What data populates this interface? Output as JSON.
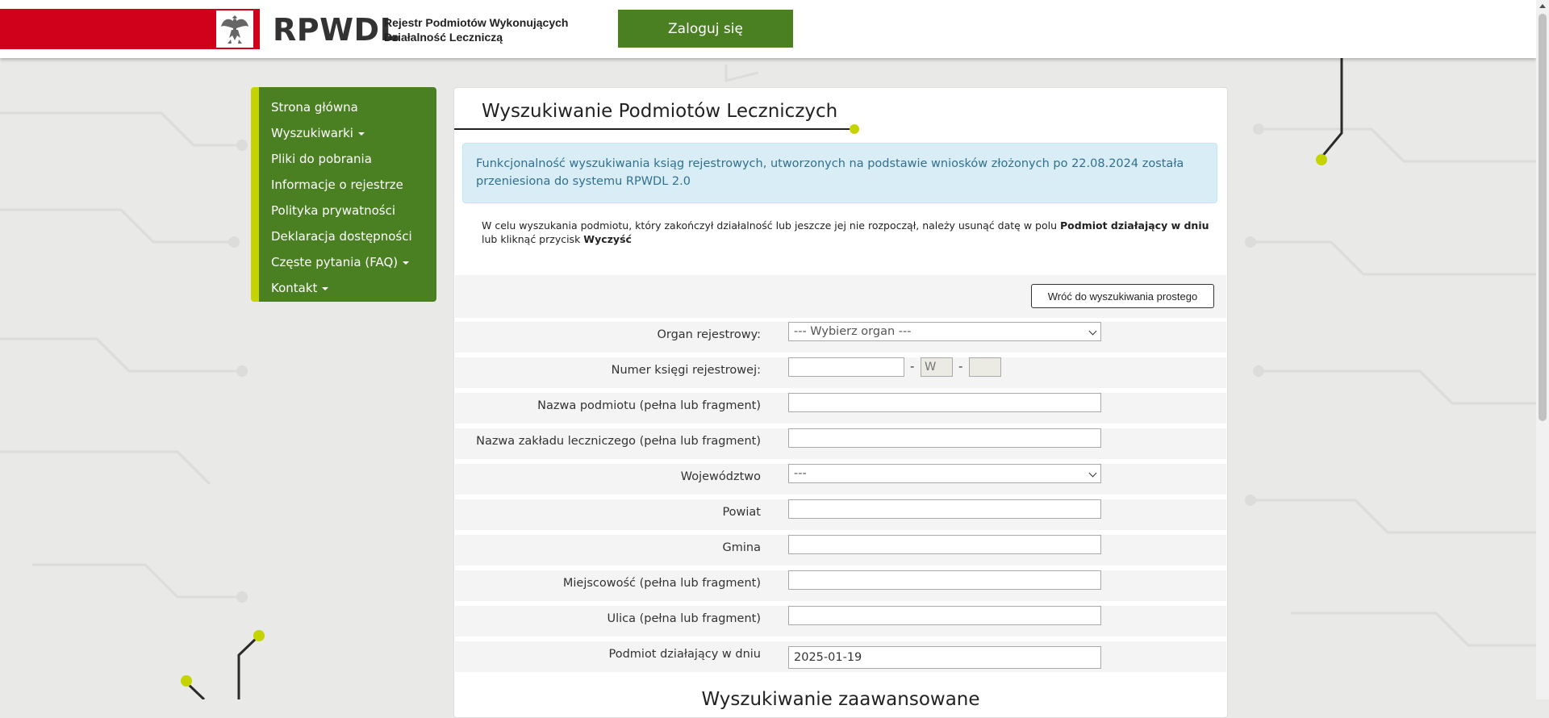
{
  "header": {
    "logo_text": "RPWDL",
    "logo_sub_line1": "Rejestr Podmiotów Wykonujących",
    "logo_sub_line2": "Działalność Leczniczą",
    "login_label": "Zaloguj się",
    "emblem_icon": "polish-eagle-emblem-icon",
    "brand_red": "#d0021b",
    "brand_green": "#4a7f22"
  },
  "sidebar": {
    "items": [
      {
        "label": "Strona główna"
      },
      {
        "label": "Wyszukiwarki"
      },
      {
        "label": "Pliki do pobrania"
      },
      {
        "label": "Informacje o rejestrze"
      },
      {
        "label": "Polityka prywatności"
      },
      {
        "label": "Deklaracja dostępności"
      },
      {
        "label": "Częste pytania (FAQ)"
      },
      {
        "label": "Kontakt"
      }
    ]
  },
  "main": {
    "title": "Wyszukiwanie Podmiotów Leczniczych",
    "alert_line1": "Funkcjonalność wyszukiwania ksiąg rejestrowych, utworzonych na podstawie wniosków złożonych po 22.08.2024 została",
    "alert_line2": "przeniesiona do systemu RPWDL 2.0",
    "info_part1": "W celu wyszukania podmiotu, który zakończył działalność lub jeszcze jej nie rozpoczął, należy usunąć datę w polu",
    "info_bold1": "Podmiot działający w dniu",
    "info_part2": "lub",
    "info_part3": "kliknąć przycisk",
    "info_bold2": "Wyczyść",
    "back_button": "Wróć do wyszukiwania prostego",
    "advanced_title": "Wyszukiwanie zaawansowane"
  },
  "form": {
    "organ_label": "Organ rejestrowy:",
    "organ_value": "--- Wybierz organ ---",
    "numer_label": "Numer księgi rejestrowej:",
    "numer_value": "",
    "numer_mid": "W",
    "numer_last": "",
    "nazwa_podmiotu_label": "Nazwa podmiotu (pełna lub fragment)",
    "nazwa_podmiotu_value": "",
    "nazwa_zakladu_label": "Nazwa zakładu leczniczego (pełna lub fragment)",
    "nazwa_zakladu_value": "",
    "wojewodztwo_label": "Województwo",
    "wojewodztwo_value": "---",
    "powiat_label": "Powiat",
    "powiat_value": "",
    "gmina_label": "Gmina",
    "gmina_value": "",
    "miejscowosc_label": "Miejscowość (pełna lub fragment)",
    "miejscowosc_value": "",
    "ulica_label": "Ulica (pełna lub fragment)",
    "ulica_value": "",
    "data_label": "Podmiot działający w dniu",
    "data_value": "2025-01-19"
  }
}
